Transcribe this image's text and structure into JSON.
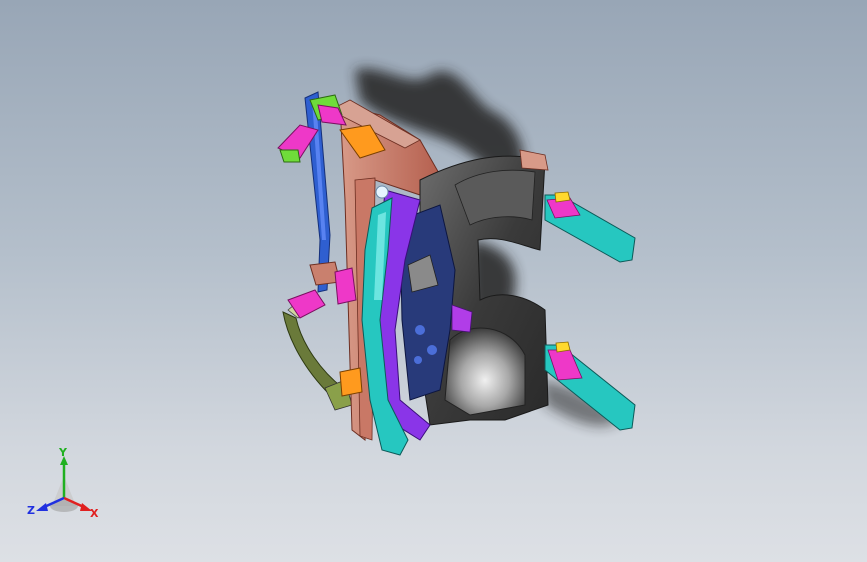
{
  "viewport": {
    "background_top": "#98a6b6",
    "background_bottom": "#dde0e5"
  },
  "triad": {
    "x_label": "X",
    "y_label": "Y",
    "z_label": "Z",
    "x_color": "#e02020",
    "y_color": "#20b020",
    "z_color": "#2030e0"
  },
  "model": {
    "description_icon": "car-body-front-structure-assembly",
    "part_colors": [
      "#2f5fd0",
      "#c9806e",
      "#8a35e8",
      "#26c7c0",
      "#ee38c8",
      "#4c4c4c",
      "#ff9a1e",
      "#6fdc3a"
    ]
  }
}
